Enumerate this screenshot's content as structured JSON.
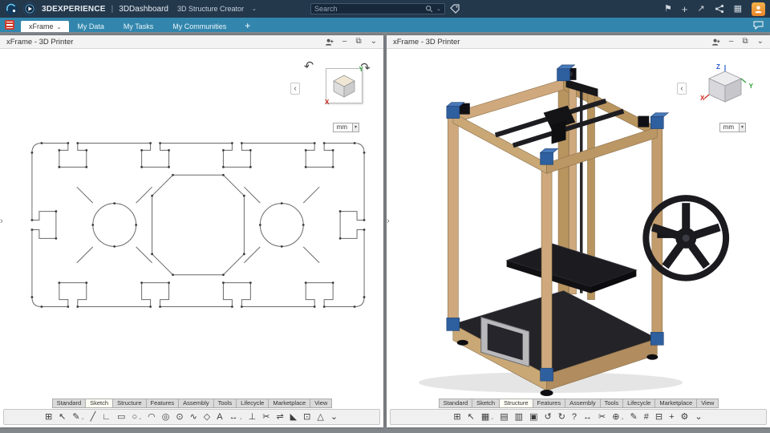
{
  "topbar": {
    "brand": "3DEXPERIENCE",
    "divider": "|",
    "app_name": "3DDashboard",
    "context_label": "3D Structure Creator",
    "context_caret": "⌄",
    "search_placeholder": "Search",
    "search_caret": "⌄"
  },
  "tabbar": {
    "tabs": [
      {
        "name": "tab-xframe",
        "label": "xFrame",
        "active": true,
        "caret": "⌄"
      },
      {
        "name": "tab-my-data",
        "label": "My Data"
      },
      {
        "name": "tab-my-tasks",
        "label": "My Tasks"
      },
      {
        "name": "tab-my-communities",
        "label": "My Communities"
      }
    ],
    "add_label": "+"
  },
  "panel_controls": {
    "minimize": "–",
    "maximize": "⧉",
    "collapse": "⌄"
  },
  "viewport": {
    "unit": "mm",
    "unit_caret": "▾",
    "nav_back": "‹",
    "rotate_ccw": "↶",
    "rotate_cw": "↷",
    "expander": "›",
    "axes": {
      "x": "X",
      "y": "Y",
      "z": "Z"
    }
  },
  "panels": {
    "left": {
      "title": "xFrame - 3D Printer",
      "ribbon_tabs": [
        {
          "name": "ribbon-tab-standard",
          "label": "Standard"
        },
        {
          "name": "ribbon-tab-sketch",
          "label": "Sketch",
          "active": true
        },
        {
          "name": "ribbon-tab-structure",
          "label": "Structure"
        },
        {
          "name": "ribbon-tab-features",
          "label": "Features"
        },
        {
          "name": "ribbon-tab-assembly",
          "label": "Assembly"
        },
        {
          "name": "ribbon-tab-tools",
          "label": "Tools"
        },
        {
          "name": "ribbon-tab-lifecycle",
          "label": "Lifecycle"
        },
        {
          "name": "ribbon-tab-marketplace",
          "label": "Marketplace"
        },
        {
          "name": "ribbon-tab-view",
          "label": "View"
        }
      ],
      "tools": [
        {
          "name": "clipboard-icon",
          "glyph": "⊞"
        },
        {
          "name": "select-icon",
          "glyph": "↖"
        },
        {
          "name": "sketch-edit-icon",
          "glyph": "✎",
          "caret": "⌄"
        },
        {
          "name": "line-icon",
          "glyph": "╱"
        },
        {
          "name": "polyline-icon",
          "glyph": "∟"
        },
        {
          "name": "rectangle-icon",
          "glyph": "▭"
        },
        {
          "name": "circle-icon",
          "glyph": "○",
          "caret": "⌄"
        },
        {
          "name": "arc-icon",
          "glyph": "◠"
        },
        {
          "name": "concentric-circle-icon",
          "glyph": "◎"
        },
        {
          "name": "ellipse-icon",
          "glyph": "⊙"
        },
        {
          "name": "spline-icon",
          "glyph": "∿"
        },
        {
          "name": "polygon-icon",
          "glyph": "◇"
        },
        {
          "name": "text-icon",
          "glyph": "A"
        },
        {
          "name": "dimension-icon",
          "glyph": "↔",
          "caret": "⌄"
        },
        {
          "name": "constraint-icon",
          "glyph": "⊥"
        },
        {
          "name": "trim-icon",
          "glyph": "✂"
        },
        {
          "name": "mirror-icon",
          "glyph": "⇌"
        },
        {
          "name": "corner-icon",
          "glyph": "◣"
        },
        {
          "name": "project-icon",
          "glyph": "⊡"
        },
        {
          "name": "triangle-icon",
          "glyph": "△"
        },
        {
          "name": "overflow-icon",
          "glyph": "⌄"
        }
      ]
    },
    "right": {
      "title": "xFrame - 3D Printer",
      "ribbon_tabs": [
        {
          "name": "ribbon-tab-standard",
          "label": "Standard"
        },
        {
          "name": "ribbon-tab-sketch",
          "label": "Sketch"
        },
        {
          "name": "ribbon-tab-structure",
          "label": "Structure",
          "active": true
        },
        {
          "name": "ribbon-tab-features",
          "label": "Features"
        },
        {
          "name": "ribbon-tab-assembly",
          "label": "Assembly"
        },
        {
          "name": "ribbon-tab-tools",
          "label": "Tools"
        },
        {
          "name": "ribbon-tab-lifecycle",
          "label": "Lifecycle"
        },
        {
          "name": "ribbon-tab-marketplace",
          "label": "Marketplace"
        },
        {
          "name": "ribbon-tab-view",
          "label": "View"
        }
      ],
      "tools": [
        {
          "name": "clipboard-icon",
          "glyph": "⊞"
        },
        {
          "name": "select-icon",
          "glyph": "↖"
        },
        {
          "name": "frame-icon",
          "glyph": "▦",
          "caret": "⌄"
        },
        {
          "name": "beam-icon",
          "glyph": "▤"
        },
        {
          "name": "column-icon",
          "glyph": "▥"
        },
        {
          "name": "plate-icon",
          "glyph": "▣"
        },
        {
          "name": "undo-icon",
          "glyph": "↺"
        },
        {
          "name": "redo-icon",
          "glyph": "↻"
        },
        {
          "name": "help-icon",
          "glyph": "?"
        },
        {
          "name": "measure-icon",
          "glyph": "↔"
        },
        {
          "name": "cut-icon",
          "glyph": "✂"
        },
        {
          "name": "connector-icon",
          "glyph": "⊕",
          "caret": "⌄"
        },
        {
          "name": "engrave-icon",
          "glyph": "✎"
        },
        {
          "name": "section-icon",
          "glyph": "#"
        },
        {
          "name": "structure-tree-icon",
          "glyph": "⊟"
        },
        {
          "name": "add-icon",
          "glyph": "+"
        },
        {
          "name": "settings-icon",
          "glyph": "⚙"
        },
        {
          "name": "overflow-icon",
          "glyph": "⌄"
        }
      ]
    }
  },
  "colors": {
    "topbar_bg": "#24384c",
    "tabbar_bg": "#3286ad",
    "accent_blue": "#2e5f9f",
    "frame_tan": "#cfa97d",
    "axis_x_red": "#cc2a1e",
    "axis_y_green": "#2e9e3a",
    "axis_z_blue": "#2b5fd0",
    "avatar_orange": "#e8832a"
  }
}
